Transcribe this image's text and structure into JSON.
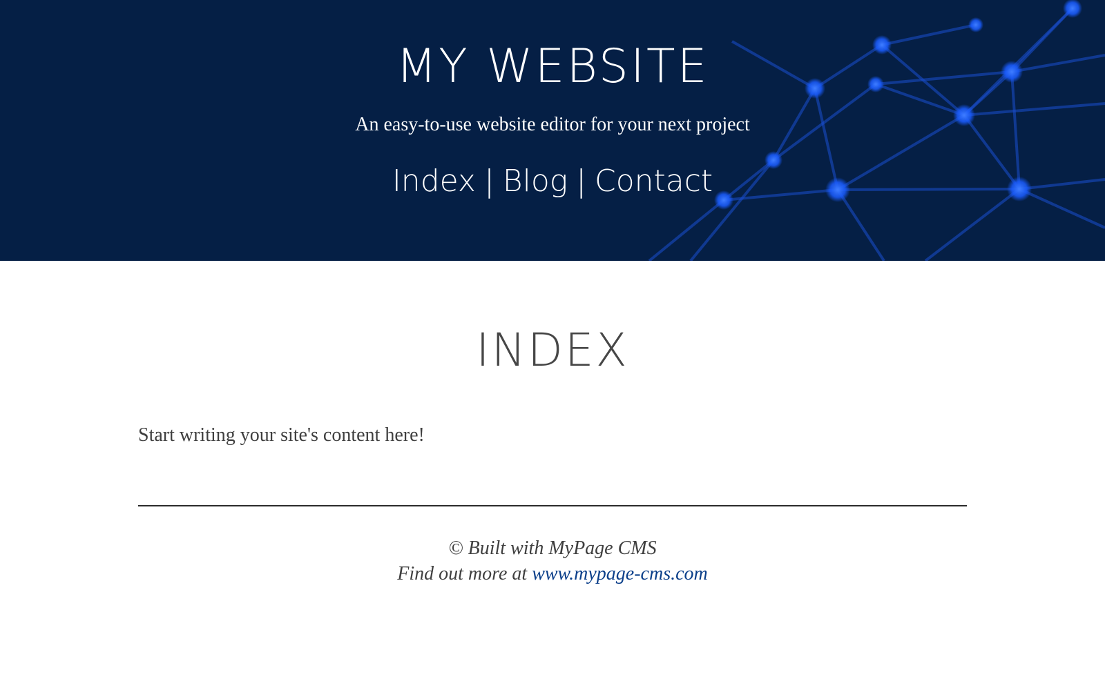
{
  "header": {
    "title": "MY WEBSITE",
    "tagline": "An easy-to-use website editor for your next project",
    "nav": {
      "items": [
        "Index",
        "Blog",
        "Contact"
      ],
      "separator": "|"
    }
  },
  "main": {
    "title": "INDEX",
    "body": "Start writing your site's content here!"
  },
  "footer": {
    "built_with": "© Built with MyPage CMS",
    "find_out_prefix": "Find out more at",
    "link_text": "www.mypage-cms.com"
  },
  "colors": {
    "header_background": "#051f45",
    "network_node": "#1a5cff",
    "footer_link": "#0b3f8a"
  }
}
